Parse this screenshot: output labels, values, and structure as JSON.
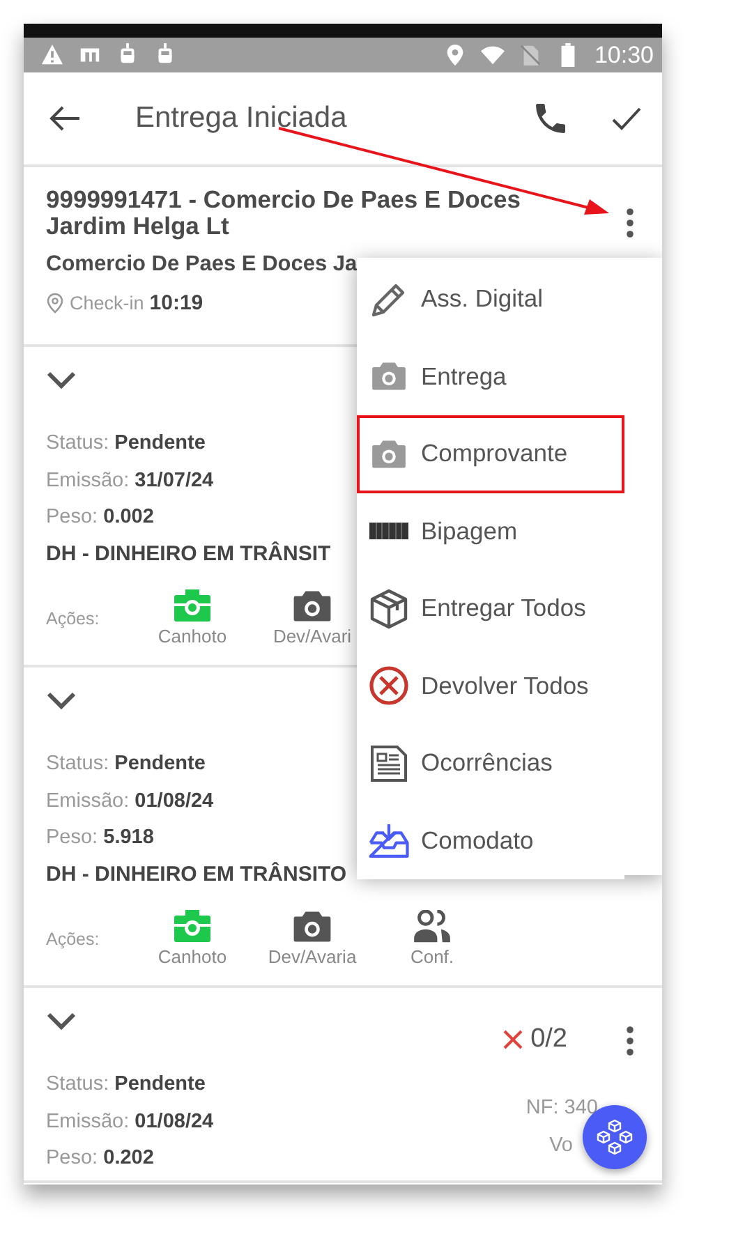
{
  "status_bar": {
    "time": "10:30"
  },
  "app_bar": {
    "title": "Entrega Iniciada"
  },
  "customer": {
    "title": "9999991471 - Comercio De Paes E Doces Jardim Helga Lt",
    "subtitle": "Comercio De Paes E Doces Ja",
    "checkin_label": "Check-in",
    "checkin_time": "10:19"
  },
  "documents": [
    {
      "fields": [
        {
          "label": "Status:",
          "value": "Pendente"
        },
        {
          "label": "Emissão:",
          "value": "31/07/24"
        },
        {
          "label": "Peso:",
          "value": "0.002"
        }
      ],
      "payment": "DH - DINHEIRO EM TRÂNSIT",
      "actions_label": "Ações:",
      "actions": [
        {
          "kind": "canhoto",
          "label": "Canhoto"
        },
        {
          "kind": "camera",
          "label": "Dev/Avari"
        }
      ]
    },
    {
      "fields": [
        {
          "label": "Status:",
          "value": "Pendente"
        },
        {
          "label": "Emissão:",
          "value": "01/08/24"
        },
        {
          "label": "Peso:",
          "value": "5.918"
        }
      ],
      "payment": "DH - DINHEIRO EM TRÂNSITO",
      "actions_label": "Ações:",
      "actions": [
        {
          "kind": "canhoto",
          "label": "Canhoto"
        },
        {
          "kind": "camera",
          "label": "Dev/Avaria"
        },
        {
          "kind": "people",
          "label": "Conf."
        }
      ]
    },
    {
      "fields": [
        {
          "label": "Status:",
          "value": "Pendente"
        },
        {
          "label": "Emissão:",
          "value": "01/08/24"
        },
        {
          "label": "Peso:",
          "value": "0.202"
        }
      ],
      "progress": "0/2",
      "nf": "NF: 340",
      "volume": "Vo"
    }
  ],
  "menu": {
    "items": [
      {
        "kind": "pencil",
        "label": "Ass. Digital",
        "highlighted": false
      },
      {
        "kind": "camera",
        "label": "Entrega",
        "highlighted": false
      },
      {
        "kind": "camera",
        "label": "Comprovante",
        "highlighted": true
      },
      {
        "kind": "barcode",
        "label": "Bipagem",
        "highlighted": false
      },
      {
        "kind": "box",
        "label": "Entregar Todos",
        "highlighted": false
      },
      {
        "kind": "cancel",
        "label": "Devolver Todos",
        "highlighted": false
      },
      {
        "kind": "document",
        "label": "Ocorrências",
        "highlighted": false
      },
      {
        "kind": "inbox",
        "label": "Comodato",
        "highlighted": false
      }
    ]
  }
}
